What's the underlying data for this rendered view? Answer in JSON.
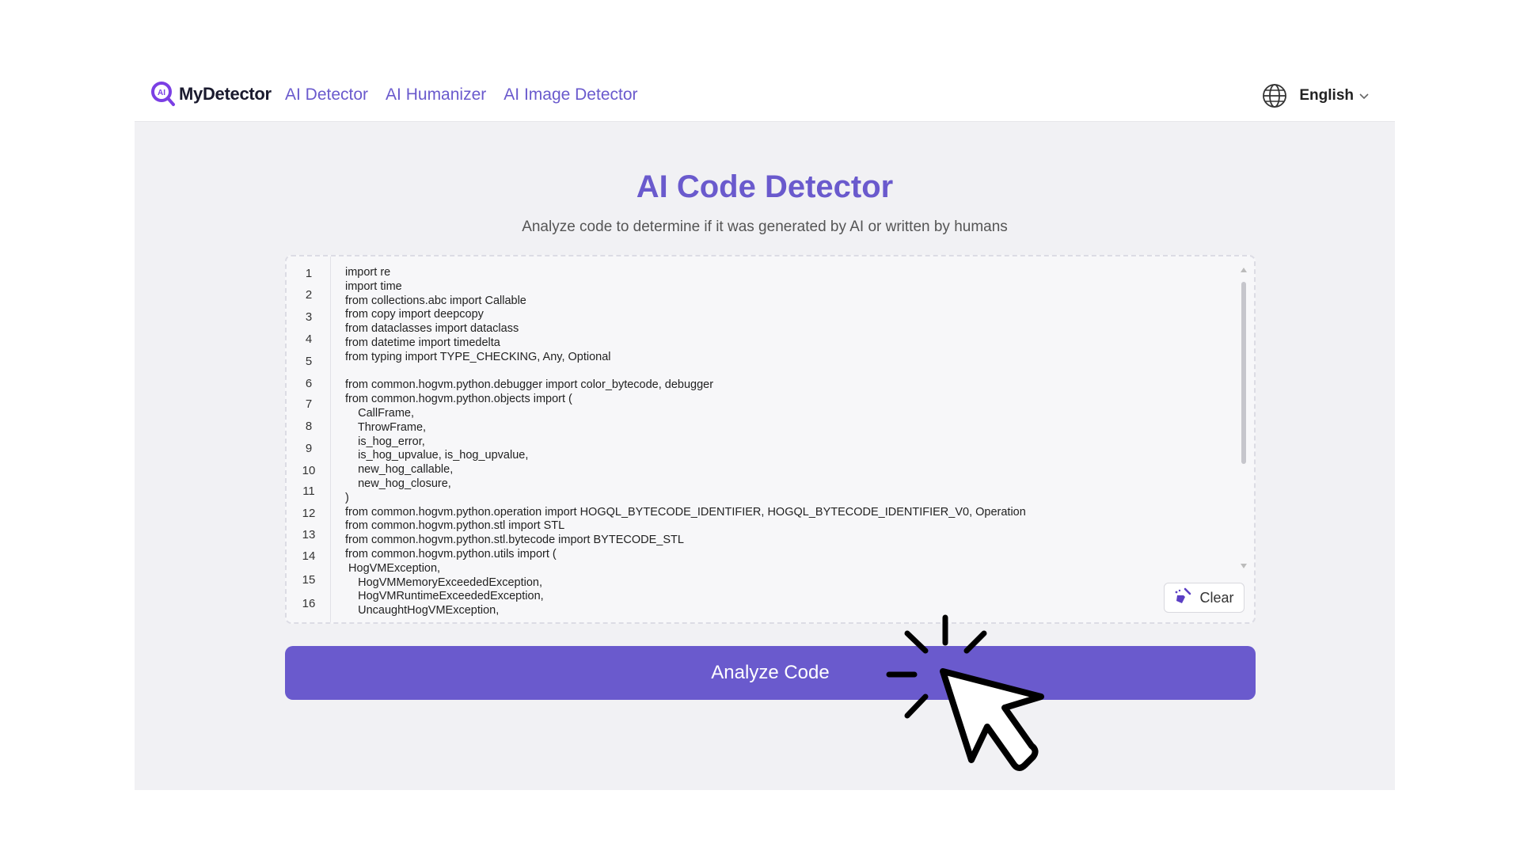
{
  "header": {
    "logo_text": "MyDetector",
    "nav": [
      "AI Detector",
      "AI Humanizer",
      "AI Image Detector"
    ],
    "language": "English"
  },
  "main": {
    "title": "AI Code Detector",
    "subtitle": "Analyze code to determine if it was generated by AI or written by humans",
    "line_numbers": [
      "1",
      "2",
      "3",
      "4",
      "5",
      "6",
      "7",
      "8",
      "9",
      "10",
      "11",
      "12",
      "13",
      "14",
      "15",
      "16"
    ],
    "code_lines": [
      "import re",
      "import time",
      "from collections.abc import Callable",
      "from copy import deepcopy",
      "from dataclasses import dataclass",
      "from datetime import timedelta",
      "from typing import TYPE_CHECKING, Any, Optional",
      "",
      "from common.hogvm.python.debugger import color_bytecode, debugger",
      "from common.hogvm.python.objects import (",
      "    CallFrame,",
      "    ThrowFrame,",
      "    is_hog_error,",
      "    is_hog_upvalue, is_hog_upvalue,",
      "    new_hog_callable,",
      "    new_hog_closure,",
      ")",
      "from common.hogvm.python.operation import HOGQL_BYTECODE_IDENTIFIER, HOGQL_BYTECODE_IDENTIFIER_V0, Operation",
      "from common.hogvm.python.stl import STL",
      "from common.hogvm.python.stl.bytecode import BYTECODE_STL",
      "from common.hogvm.python.utils import (",
      " HogVMException,",
      "    HogVMMemoryExceededException,",
      "    HogVMRuntimeExceededException,",
      "    UncaughtHogVMException,"
    ],
    "clear_label": "Clear",
    "analyze_label": "Analyze Code"
  },
  "colors": {
    "accent": "#6a5acd",
    "background": "#f1f1f4"
  }
}
